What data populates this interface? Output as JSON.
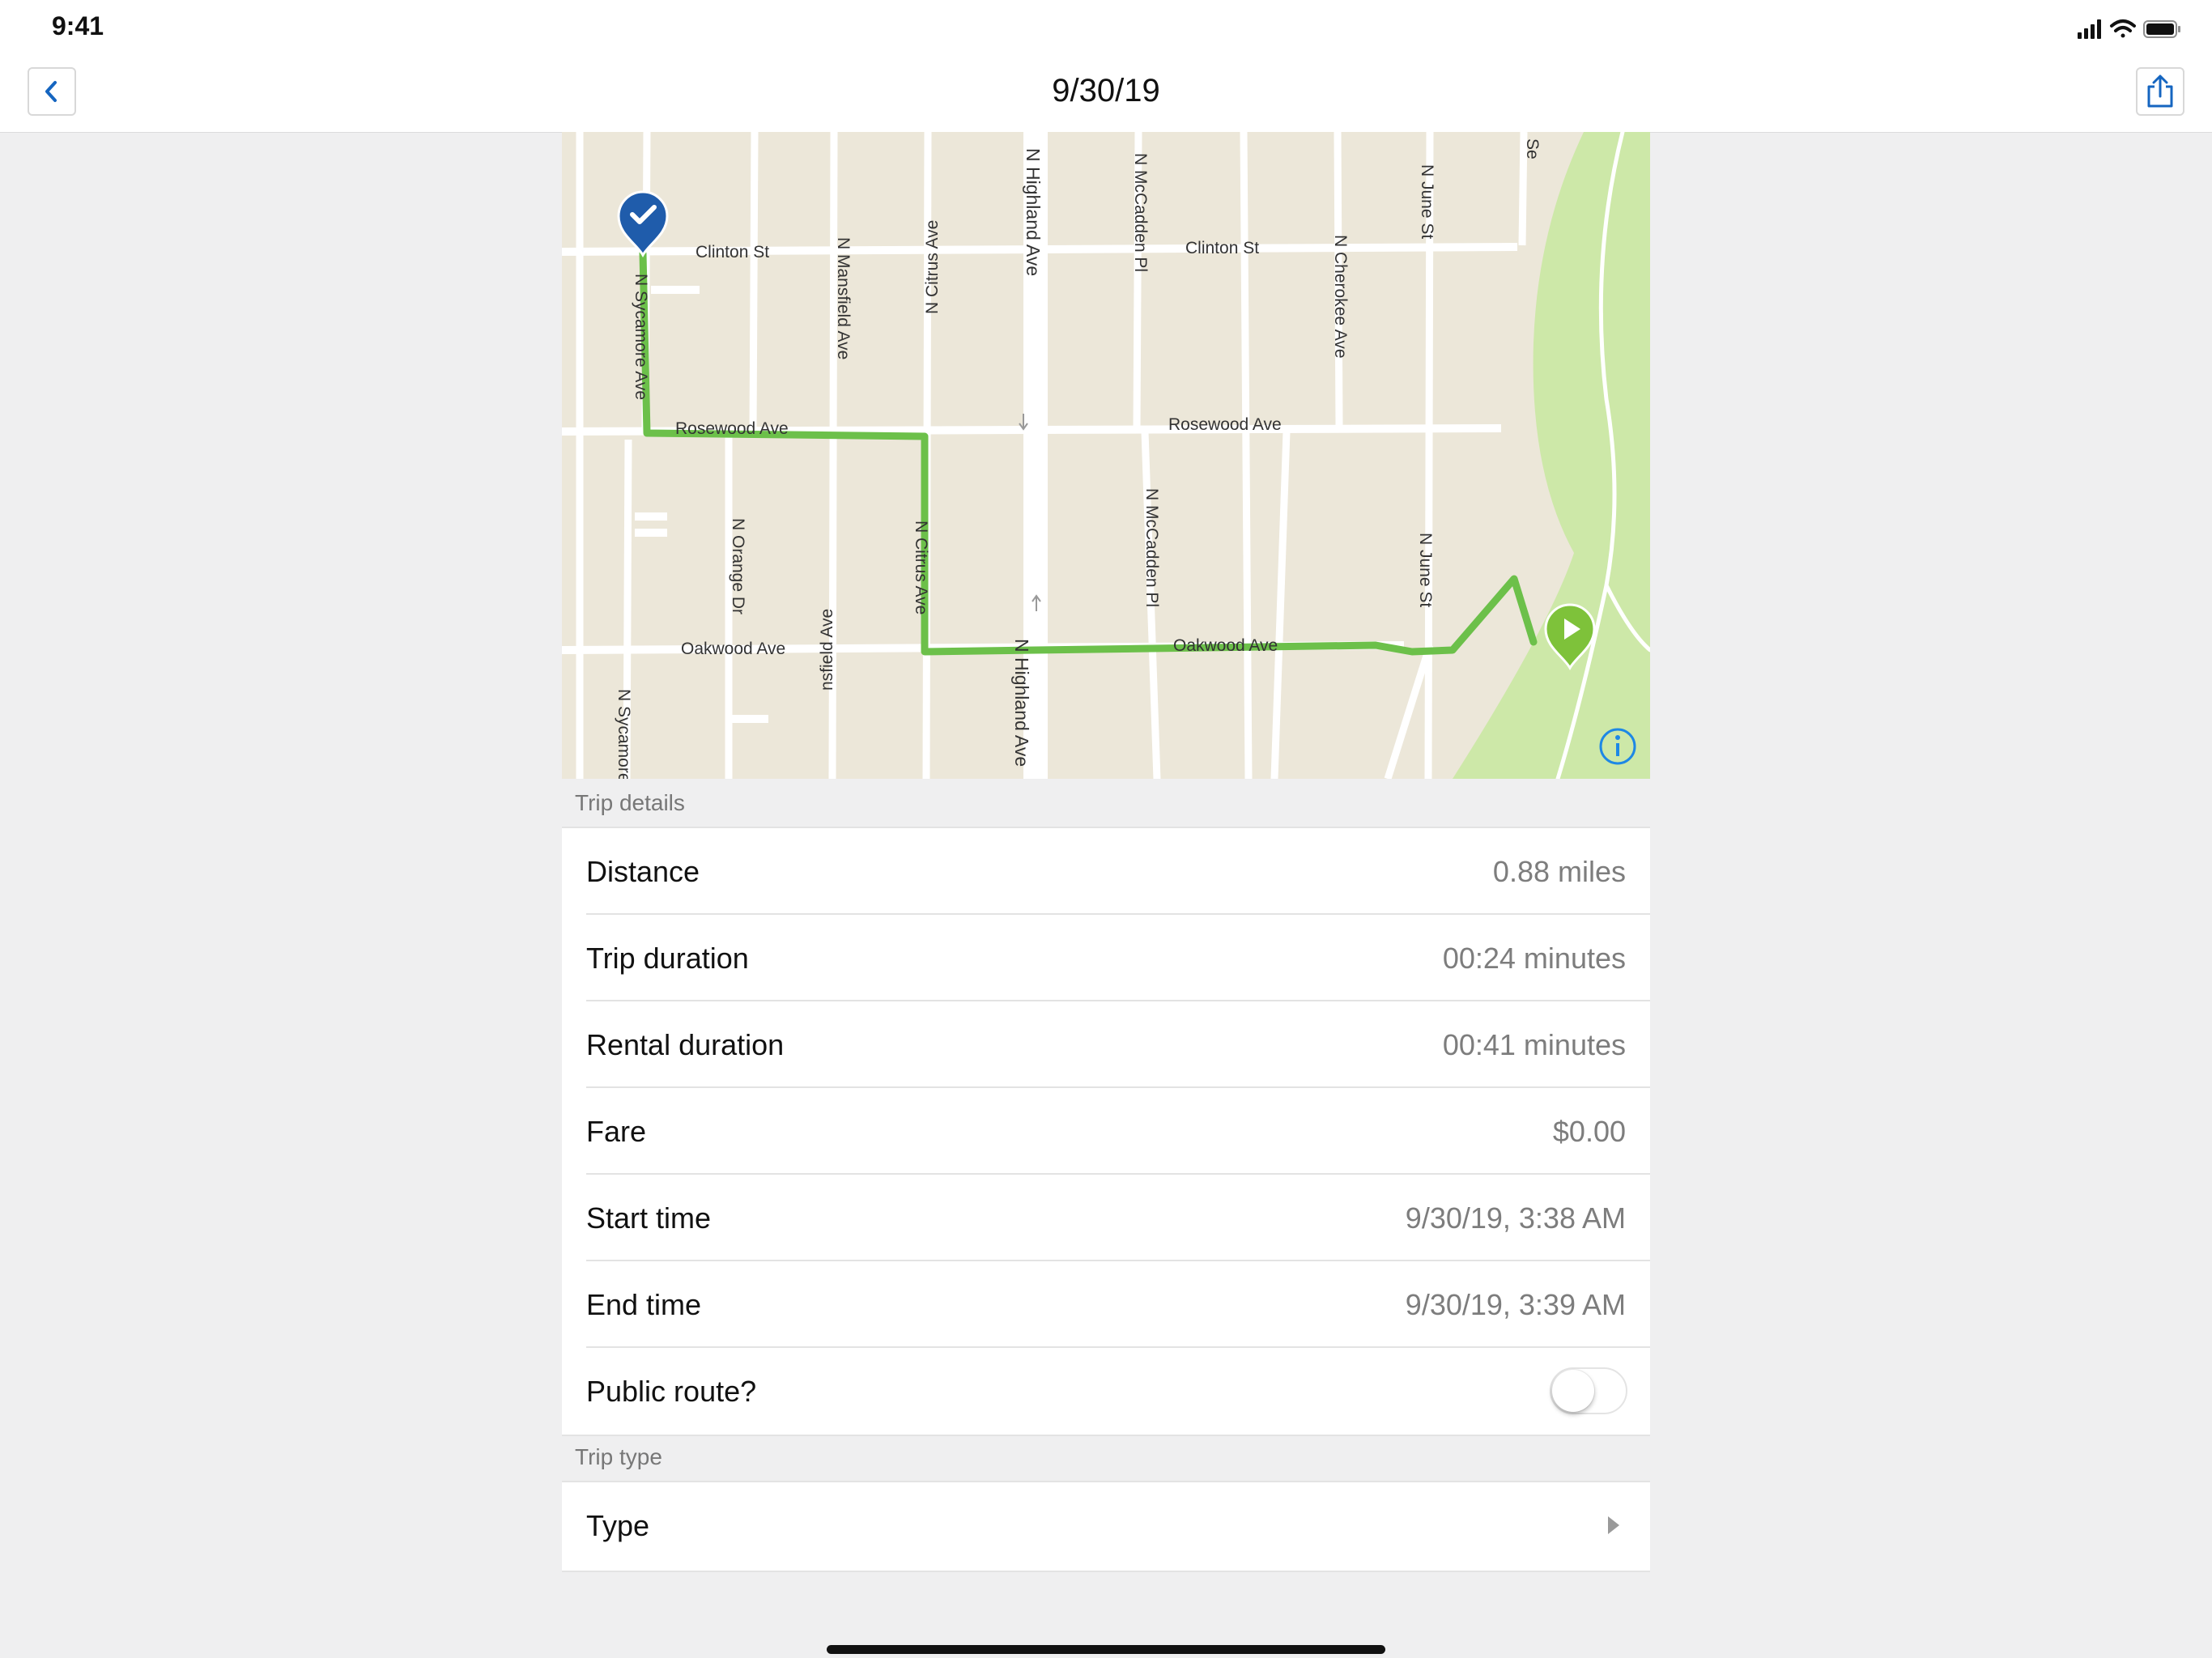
{
  "status_bar": {
    "time": "9:41"
  },
  "nav": {
    "title": "9/30/19",
    "back_icon": "chevron-left-icon",
    "share_icon": "share-icon"
  },
  "colors": {
    "accent": "#1565c0",
    "route": "#6cc04a",
    "park": "#cde8a8",
    "map_bg": "#ece7d9",
    "start_pin": "#1f5cab",
    "end_pin": "#7ec23a"
  },
  "map": {
    "streets": {
      "clinton_st_west": "Clinton St",
      "clinton_st_east": "Clinton St",
      "rosewood_ave_west": "Rosewood Ave",
      "rosewood_ave_east": "Rosewood Ave",
      "oakwood_ave_west": "Oakwood Ave",
      "oakwood_ave_east": "Oakwood Ave",
      "n_sycamore_north": "N Sycamore Ave",
      "n_sycamore_south": "N Sycamore",
      "n_mansfield_north": "N Mansfield Ave",
      "n_mansfield_south": "nsfield Ave",
      "n_orange": "N Orange Dr",
      "n_citrus_north": "N Citrus Ave",
      "n_citrus_south": "N Citrus Ave",
      "n_highland_north": "N Highland Ave",
      "n_highland_south": "N Highland Ave",
      "n_mccadden_north": "N McCadden Pl",
      "n_mccadden_south": "N McCadden Pl",
      "n_cherokee": "N Cherokee Ave",
      "n_june_north": "N June St",
      "n_june_south": "N June St",
      "se_partial": "Se"
    },
    "start_marker_icon": "checkmark-pin-icon",
    "end_marker_icon": "play-pin-icon",
    "info_icon": "info-icon"
  },
  "trip_details": {
    "header": "Trip details",
    "rows": [
      {
        "label": "Distance",
        "value": "0.88 miles"
      },
      {
        "label": "Trip duration",
        "value": "00:24 minutes"
      },
      {
        "label": "Rental duration",
        "value": "00:41 minutes"
      },
      {
        "label": "Fare",
        "value": "$0.00"
      },
      {
        "label": "Start time",
        "value": "9/30/19, 3:38 AM"
      },
      {
        "label": "End time",
        "value": "9/30/19, 3:39 AM"
      }
    ],
    "public_route": {
      "label": "Public route?",
      "enabled": false
    }
  },
  "trip_type": {
    "header": "Trip type",
    "row_label": "Type",
    "chevron_icon": "chevron-right-icon"
  }
}
